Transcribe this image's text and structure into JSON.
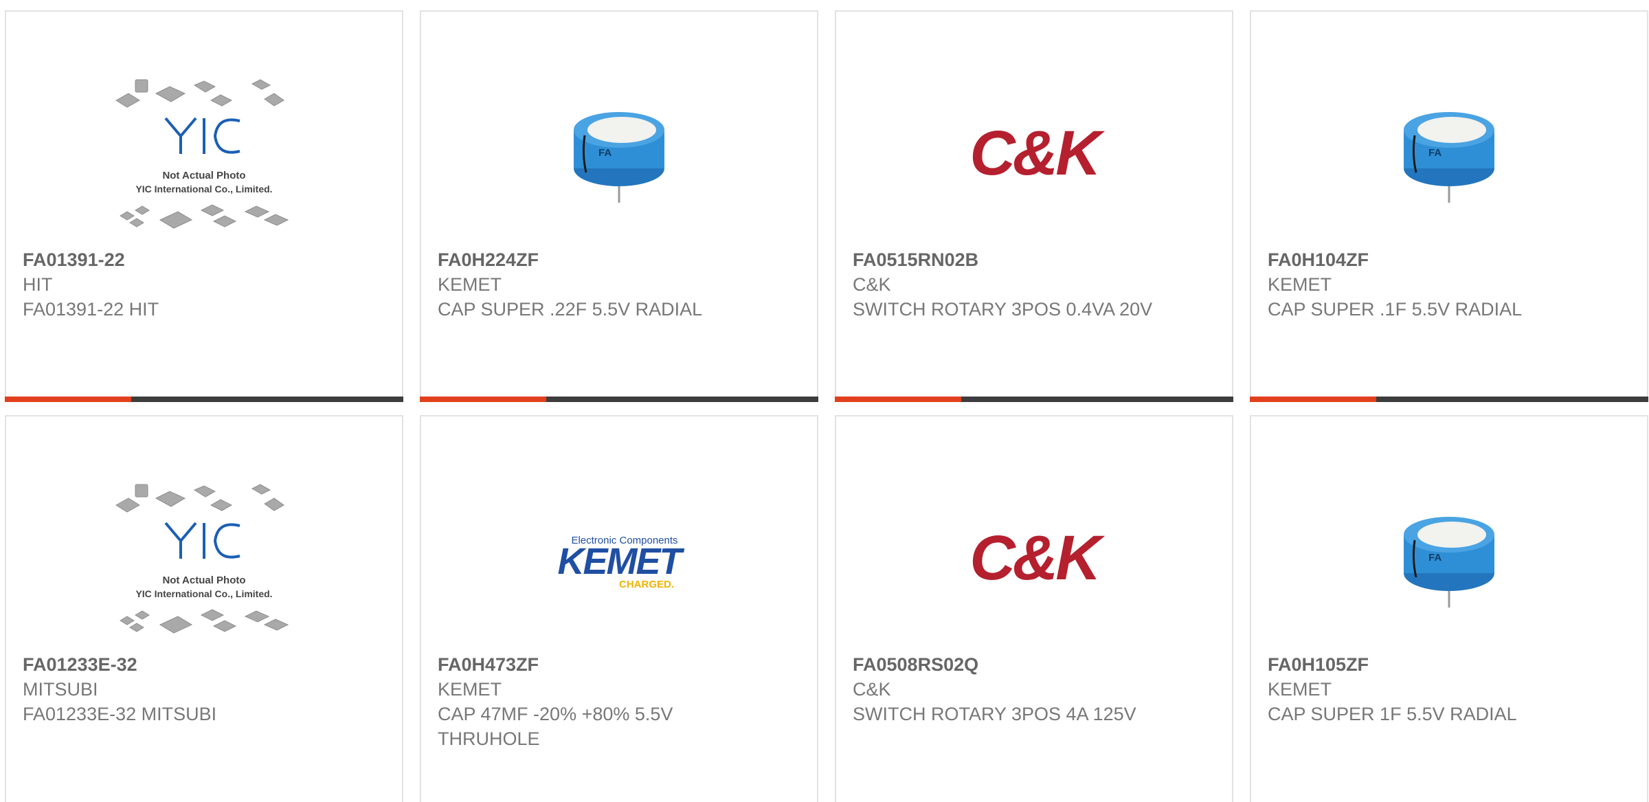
{
  "colors": {
    "accent": "#e2401c",
    "bar": "#3d3d3d",
    "capacitor": "#2f8fd6",
    "ck_red": "#b5202e",
    "kemet_blue": "#1f4fa3",
    "kemet_yellow": "#f2b300"
  },
  "placeholder": {
    "brand": "YIC",
    "line1": "Not Actual Photo",
    "line2": "YIC International Co., Limited."
  },
  "capacitor_marking": "FA",
  "ck_logo_text": "C&K",
  "kemet_logo": {
    "tagline": "Electronic Components",
    "name": "KEMET",
    "slogan": "CHARGED."
  },
  "products": [
    {
      "part_number": "FA01391-22",
      "manufacturer": "HIT",
      "description": "FA01391-22 HIT",
      "image": "yic-placeholder"
    },
    {
      "part_number": "FA0H224ZF",
      "manufacturer": "KEMET",
      "description": "CAP SUPER .22F 5.5V RADIAL",
      "image": "capacitor"
    },
    {
      "part_number": "FA0515RN02B",
      "manufacturer": "C&K",
      "description": "SWITCH ROTARY 3POS 0.4VA 20V",
      "image": "ck-logo"
    },
    {
      "part_number": "FA0H104ZF",
      "manufacturer": "KEMET",
      "description": "CAP SUPER .1F 5.5V RADIAL",
      "image": "capacitor"
    },
    {
      "part_number": "FA01233E-32",
      "manufacturer": "MITSUBI",
      "description": "FA01233E-32 MITSUBI",
      "image": "yic-placeholder"
    },
    {
      "part_number": "FA0H473ZF",
      "manufacturer": "KEMET",
      "description": "CAP 47MF -20% +80% 5.5V THRUHOLE",
      "image": "kemet-logo"
    },
    {
      "part_number": "FA0508RS02Q",
      "manufacturer": "C&K",
      "description": "SWITCH ROTARY 3POS 4A 125V",
      "image": "ck-logo"
    },
    {
      "part_number": "FA0H105ZF",
      "manufacturer": "KEMET",
      "description": "CAP SUPER 1F 5.5V RADIAL",
      "image": "capacitor"
    }
  ]
}
